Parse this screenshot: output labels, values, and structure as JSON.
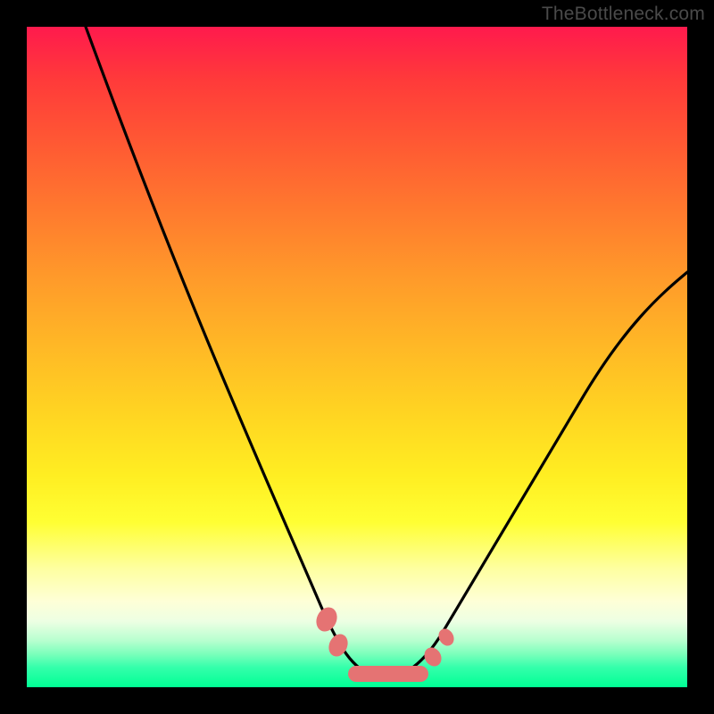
{
  "watermark": "TheBottleneck.com",
  "chart_data": {
    "type": "line",
    "title": "",
    "xlabel": "",
    "ylabel": "",
    "xlim": [
      0,
      100
    ],
    "ylim": [
      0,
      100
    ],
    "grid": false,
    "legend": false,
    "background": "red-to-green vertical gradient",
    "annotations": [
      "pink marker blobs near curve minimum, y≈3–8"
    ],
    "series": [
      {
        "name": "curve",
        "x": [
          9,
          12,
          16,
          20,
          24,
          28,
          32,
          36,
          40,
          43,
          46,
          48,
          50,
          52,
          55,
          58,
          60,
          63,
          67,
          72,
          78,
          84,
          90,
          96,
          100
        ],
        "y": [
          100,
          93,
          84,
          74,
          65,
          56,
          46,
          37,
          27,
          19,
          12,
          8,
          4,
          2,
          1,
          1,
          2,
          5,
          10,
          18,
          28,
          38,
          48,
          57,
          63
        ]
      }
    ],
    "markers": [
      {
        "x": 46.5,
        "y": 8.5
      },
      {
        "x": 47.5,
        "y": 5.5
      },
      {
        "x": 50.5,
        "y": 2.5
      },
      {
        "x": 55.0,
        "y": 2.0
      },
      {
        "x": 59.0,
        "y": 2.5
      },
      {
        "x": 62.0,
        "y": 4.5
      },
      {
        "x": 64.0,
        "y": 7.0
      }
    ]
  }
}
